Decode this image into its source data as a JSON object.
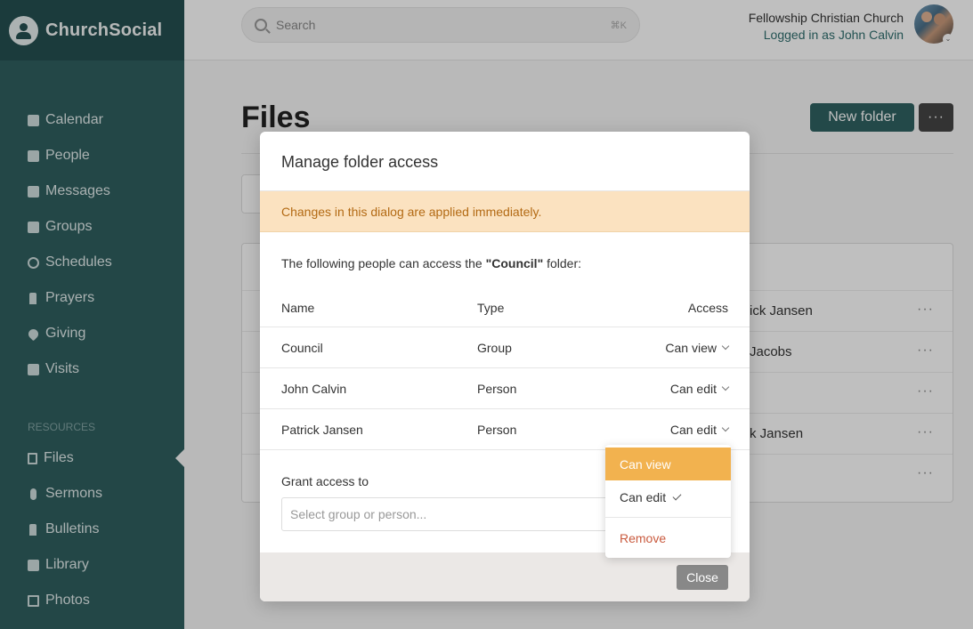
{
  "brand": {
    "name": "ChurchSocial"
  },
  "sidebar": {
    "items": [
      {
        "label": "Calendar",
        "icon": "calendar-icon"
      },
      {
        "label": "People",
        "icon": "person-icon"
      },
      {
        "label": "Messages",
        "icon": "messages-icon"
      },
      {
        "label": "Groups",
        "icon": "groups-icon"
      },
      {
        "label": "Schedules",
        "icon": "clock-icon"
      },
      {
        "label": "Prayers",
        "icon": "praying-hands-icon"
      },
      {
        "label": "Giving",
        "icon": "heart-icon"
      },
      {
        "label": "Visits",
        "icon": "coffee-icon"
      }
    ],
    "resources_label": "RESOURCES",
    "resources": [
      {
        "label": "Files",
        "icon": "file-icon"
      },
      {
        "label": "Sermons",
        "icon": "microphone-icon"
      },
      {
        "label": "Bulletins",
        "icon": "pin-icon"
      },
      {
        "label": "Library",
        "icon": "book-icon"
      },
      {
        "label": "Photos",
        "icon": "image-icon"
      }
    ]
  },
  "header": {
    "search_placeholder": "Search",
    "search_shortcut": "⌘K",
    "church_name": "Fellowship Christian Church",
    "logged_in": "Logged in as John Calvin"
  },
  "page": {
    "title": "Files",
    "new_folder": "New folder",
    "more": "···",
    "background_rows": [
      {
        "owner": "ick Jansen"
      },
      {
        "owner": "Jacobs"
      },
      {
        "owner": ""
      },
      {
        "owner": "k Jansen"
      },
      {
        "owner": ""
      }
    ]
  },
  "modal": {
    "title": "Manage folder access",
    "notice": "Changes in this dialog are applied immediately.",
    "desc_before": "The following people can access the ",
    "desc_folder": "\"Council\"",
    "desc_after": " folder:",
    "columns": {
      "name": "Name",
      "type": "Type",
      "access": "Access"
    },
    "rows": [
      {
        "name": "Council",
        "type": "Group",
        "access": "Can view"
      },
      {
        "name": "John Calvin",
        "type": "Person",
        "access": "Can edit"
      },
      {
        "name": "Patrick Jansen",
        "type": "Person",
        "access": "Can edit"
      }
    ],
    "grant_label": "Grant access to",
    "grant_placeholder": "Select group or person...",
    "close": "Close"
  },
  "dropdown": {
    "options": [
      {
        "label": "Can view",
        "highlighted": true
      },
      {
        "label": "Can edit",
        "checked": true
      }
    ],
    "remove": "Remove"
  },
  "colors": {
    "sidebar": "#2f5f5f",
    "accent": "#2f6262",
    "highlight": "#f2b24f",
    "notice_bg": "#fbe2c0",
    "danger": "#c95a3e"
  }
}
